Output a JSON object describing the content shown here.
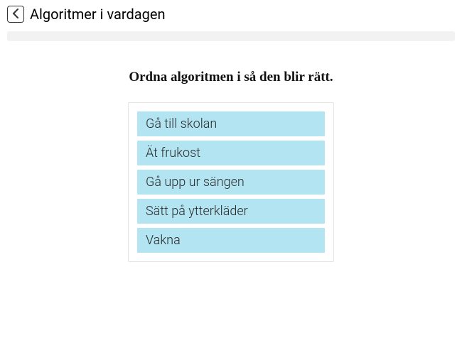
{
  "header": {
    "title": "Algoritmer i vardagen"
  },
  "instruction": "Ordna algoritmen i så den blir rätt.",
  "items": [
    "Gå till skolan",
    "Ät frukost",
    "Gå upp ur sängen",
    "Sätt på ytterkläder",
    "Vakna"
  ]
}
